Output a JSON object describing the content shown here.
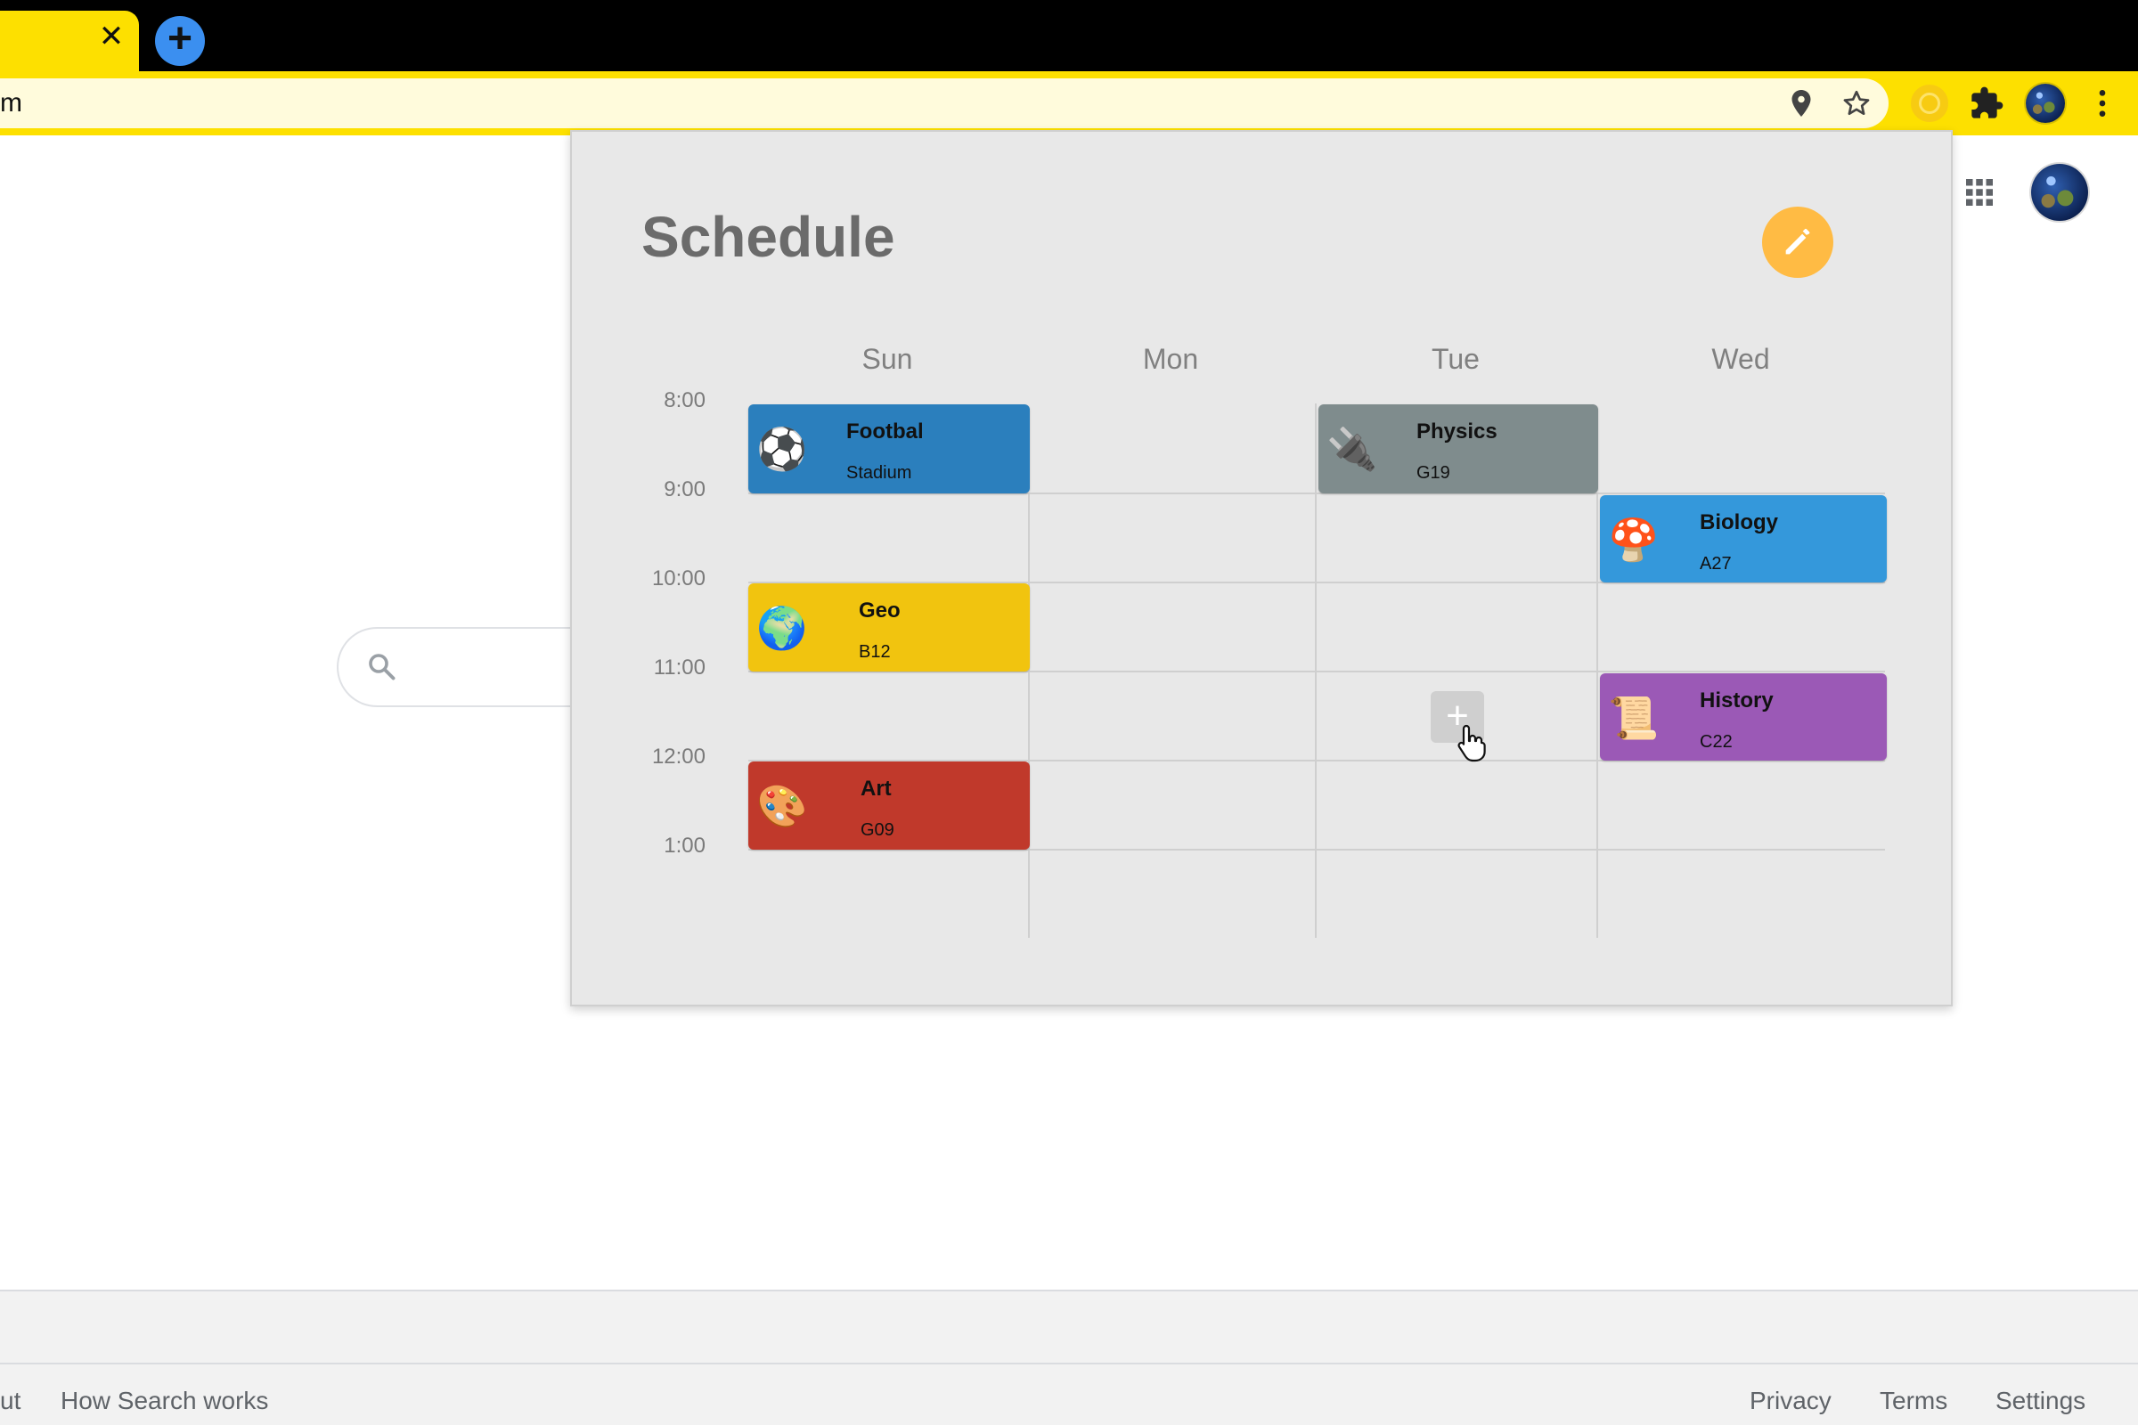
{
  "browser": {
    "tab_close_glyph": "✕",
    "new_tab_glyph": "+",
    "address_text": "m",
    "menu_glyph": "⋮"
  },
  "popup": {
    "title": "Schedule",
    "days": [
      "Sun",
      "Mon",
      "Tue",
      "Wed"
    ],
    "times": [
      "8:00",
      "9:00",
      "10:00",
      "11:00",
      "12:00",
      "1:00"
    ],
    "add_glyph": "+",
    "events": [
      {
        "title": "Footbal",
        "room": "Stadium",
        "day": "Sun",
        "start": "8:00",
        "end": "9:00",
        "color": "#2b7fbd",
        "icon": "soccer-ball-icon",
        "emoji": "⚽"
      },
      {
        "title": "Geo",
        "room": "B12",
        "day": "Sun",
        "start": "10:00",
        "end": "11:00",
        "color": "#f1c40f",
        "icon": "globe-icon",
        "emoji": "🌍"
      },
      {
        "title": "Art",
        "room": "G09",
        "day": "Sun",
        "start": "12:00",
        "end": "1:00",
        "color": "#c0392b",
        "icon": "palette-icon",
        "emoji": "🎨"
      },
      {
        "title": "Physics",
        "room": "G19",
        "day": "Tue",
        "start": "8:00",
        "end": "9:00",
        "color": "#7f8c8d",
        "icon": "plug-icon",
        "emoji": "🔌"
      },
      {
        "title": "Biology",
        "room": "A27",
        "day": "Wed",
        "start": "9:00",
        "end": "10:00",
        "color": "#3498db",
        "icon": "mushroom-icon",
        "emoji": "🍄"
      },
      {
        "title": "History",
        "room": "C22",
        "day": "Wed",
        "start": "11:00",
        "end": "12:00",
        "color": "#9b59b6",
        "icon": "scroll-icon",
        "emoji": "📜"
      }
    ]
  },
  "footer": {
    "left_links": [
      "ut",
      "How Search works"
    ],
    "right_links": [
      "Privacy",
      "Terms",
      "Settings"
    ]
  },
  "colors": {
    "accent_yellow": "#fde000",
    "edit_button": "#ffbb44",
    "popup_bg": "#e8e8e8"
  }
}
